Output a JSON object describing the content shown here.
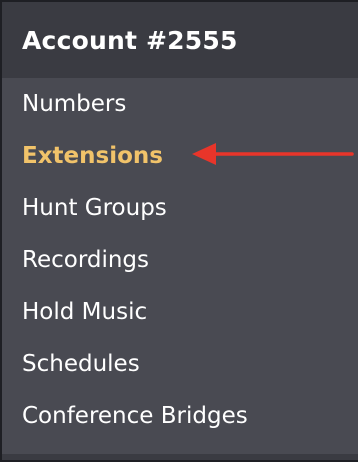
{
  "header": {
    "title": "Account #2555"
  },
  "menu": {
    "items": [
      {
        "label": "Numbers"
      },
      {
        "label": "Extensions",
        "active": true
      },
      {
        "label": "Hunt Groups"
      },
      {
        "label": "Recordings"
      },
      {
        "label": "Hold Music"
      },
      {
        "label": "Schedules"
      },
      {
        "label": "Conference Bridges"
      }
    ]
  },
  "colors": {
    "panel_bg": "#494a52",
    "header_bg": "#3a3b42",
    "active_text": "#f1c36a",
    "annotation_arrow": "#e8352a"
  },
  "annotation": {
    "icon": "red-arrow-left-icon"
  }
}
